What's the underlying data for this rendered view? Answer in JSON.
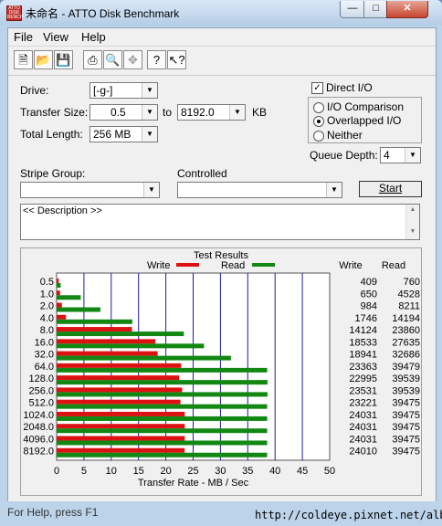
{
  "window": {
    "title": "未命名 - ATTO Disk Benchmark",
    "app_icon_text": "ATTO DISK BENCH"
  },
  "menu": {
    "file": "File",
    "view": "View",
    "help": "Help"
  },
  "toolbar": {
    "icons": [
      "new-document-icon",
      "open-folder-icon",
      "save-icon",
      "print-icon",
      "print-preview-icon",
      "move-icon",
      "help-icon",
      "context-help-icon"
    ]
  },
  "settings": {
    "drive_label": "Drive:",
    "drive_value": "[-g-]",
    "transfer_size_label": "Transfer Size:",
    "transfer_from": "0.5",
    "to_label": "to",
    "transfer_to": "8192.0",
    "kb_label": "KB",
    "total_length_label": "Total Length:",
    "total_length_value": "256 MB",
    "direct_io_label": "Direct I/O",
    "direct_io_checked": true,
    "io_comparison_label": "I/O Comparison",
    "overlapped_io_label": "Overlapped I/O",
    "neither_label": "Neither",
    "selected_mode": "Overlapped I/O",
    "queue_depth_label": "Queue Depth:",
    "queue_depth_value": "4",
    "stripe_group_label": "Stripe Group:",
    "controlled_label": "Controlled",
    "start_label": "Start",
    "description_text": "<< Description >>"
  },
  "status": {
    "help_text": "For Help, press F1",
    "watermark": "http://coldeye.pixnet.net/album"
  },
  "colors": {
    "write": "#dd1111",
    "read": "#128812",
    "grid": "#1a1aaa"
  },
  "chart_data": {
    "type": "bar",
    "title": "Test Results",
    "xlabel": "Transfer Rate - MB / Sec",
    "xlim": [
      0,
      50
    ],
    "xticks": [
      0,
      5,
      10,
      15,
      20,
      25,
      30,
      35,
      40,
      45,
      50
    ],
    "categories": [
      "0.5",
      "1.0",
      "2.0",
      "4.0",
      "8.0",
      "16.0",
      "32.0",
      "64.0",
      "128.0",
      "256.0",
      "512.0",
      "1024.0",
      "2048.0",
      "4096.0",
      "8192.0"
    ],
    "series": [
      {
        "name": "Write",
        "values": [
          409,
          650,
          984,
          1746,
          14124,
          18533,
          18941,
          23363,
          22995,
          23531,
          23221,
          24031,
          24031,
          24031,
          24010
        ]
      },
      {
        "name": "Read",
        "values": [
          760,
          4528,
          8211,
          14194,
          23860,
          27635,
          32686,
          39479,
          39539,
          39539,
          39475,
          39475,
          39475,
          39475,
          39475
        ]
      }
    ],
    "legend": [
      "Write",
      "Read"
    ],
    "column_headers": [
      "Write",
      "Read"
    ]
  }
}
